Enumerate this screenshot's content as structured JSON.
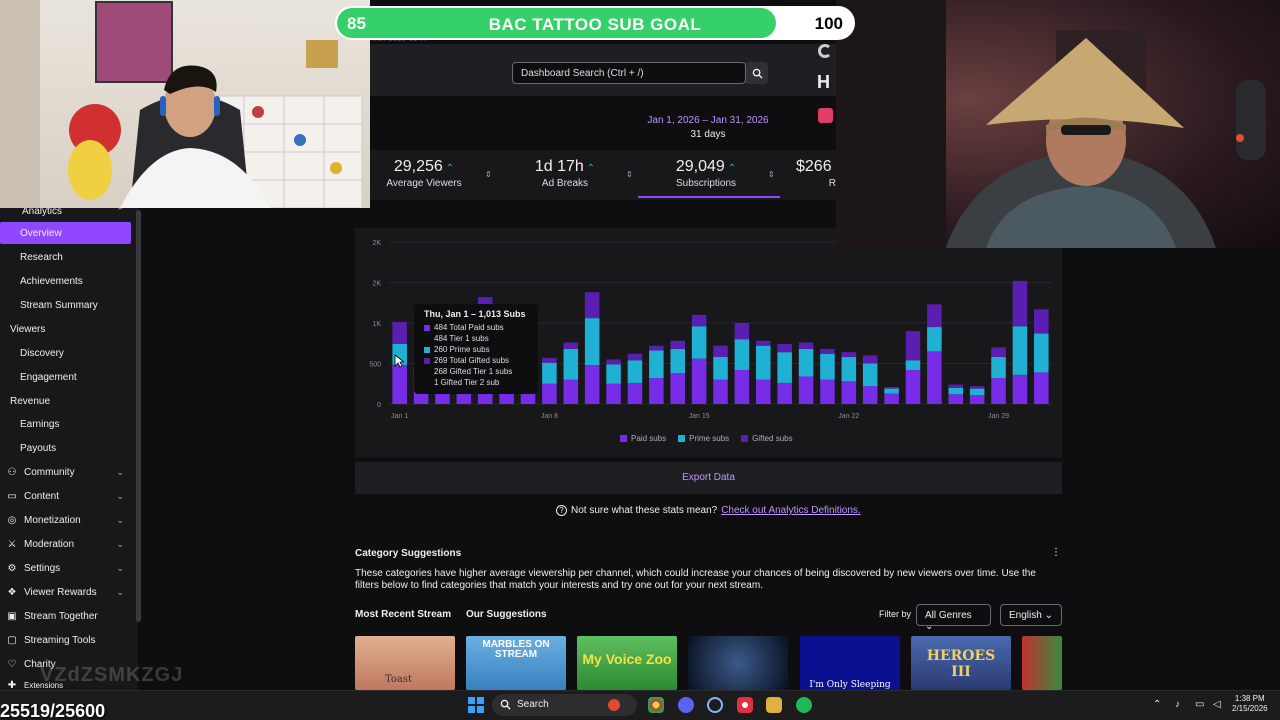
{
  "goal": {
    "current": "85",
    "title": "BAC TATTOO SUB GOAL",
    "target": "100",
    "progress": 0.85
  },
  "overlay": {
    "counter": "25519/25600",
    "watermark": "VZdZSMKZGJ"
  },
  "header": {
    "search_placeholder": "Dashboard Search (Ctrl + /)",
    "letter": "H",
    "breadcrumb": "...art 2026 01 ..."
  },
  "date": {
    "range": "Jan 1, 2026 – Jan 31, 2026",
    "days": "31 days"
  },
  "stats": [
    {
      "value": "29,256",
      "label": "Average Viewers"
    },
    {
      "value": "1d 17h",
      "label": "Ad Breaks"
    },
    {
      "value": "29,049",
      "label": "Subscriptions"
    },
    {
      "value": "$266",
      "label": "R"
    }
  ],
  "sidebar": {
    "analytics": "Analytics",
    "overview": "Overview",
    "research": "Research",
    "achievements": "Achievements",
    "stream_summary": "Stream Summary",
    "viewers": "Viewers",
    "discovery": "Discovery",
    "engagement": "Engagement",
    "revenue": "Revenue",
    "earnings": "Earnings",
    "payouts": "Payouts",
    "community": "Community",
    "content": "Content",
    "monetization": "Monetization",
    "moderation": "Moderation",
    "settings": "Settings",
    "viewer_rewards": "Viewer Rewards",
    "stream_together": "Stream Together",
    "streaming_tools": "Streaming Tools",
    "charity": "Charity",
    "extensions": "Extensions"
  },
  "chart_data": {
    "type": "bar",
    "stacked": true,
    "y_ticks": [
      "2K",
      "2K",
      "1K",
      "500",
      "0"
    ],
    "x_ticks": [
      "Jan 1",
      "Jan 8",
      "Jan 15",
      "Jan 22",
      "Jan 29"
    ],
    "categories": [
      "Jan 1",
      "Jan 2",
      "Jan 3",
      "Jan 4",
      "Jan 5",
      "Jan 6",
      "Jan 7",
      "Jan 8",
      "Jan 9",
      "Jan 10",
      "Jan 11",
      "Jan 12",
      "Jan 13",
      "Jan 14",
      "Jan 15",
      "Jan 16",
      "Jan 17",
      "Jan 18",
      "Jan 19",
      "Jan 20",
      "Jan 21",
      "Jan 22",
      "Jan 23",
      "Jan 24",
      "Jan 25",
      "Jan 26",
      "Jan 27",
      "Jan 28",
      "Jan 29",
      "Jan 30",
      "Jan 31"
    ],
    "series": [
      {
        "name": "Paid subs",
        "color": "#772ce8",
        "values": [
          484,
          350,
          300,
          280,
          900,
          420,
          300,
          250,
          300,
          480,
          250,
          260,
          320,
          380,
          560,
          300,
          420,
          300,
          260,
          340,
          300,
          280,
          220,
          130,
          420,
          650,
          120,
          110,
          320,
          360,
          390
        ]
      },
      {
        "name": "Prime subs",
        "color": "#1fb0d3",
        "values": [
          260,
          100,
          80,
          80,
          120,
          180,
          60,
          260,
          380,
          580,
          240,
          280,
          340,
          300,
          400,
          280,
          380,
          420,
          380,
          340,
          320,
          300,
          280,
          60,
          120,
          300,
          80,
          80,
          260,
          600,
          480
        ]
      },
      {
        "name": "Gifted subs",
        "color": "#5a1fb0",
        "values": [
          269,
          80,
          80,
          60,
          300,
          120,
          80,
          60,
          80,
          320,
          60,
          80,
          60,
          100,
          140,
          140,
          200,
          60,
          100,
          80,
          60,
          60,
          100,
          20,
          360,
          280,
          40,
          30,
          120,
          560,
          300
        ]
      }
    ],
    "legend": [
      "Paid subs",
      "Prime subs",
      "Gifted subs"
    ],
    "tooltip": {
      "title": "Thu, Jan 1 – 1,013 Subs",
      "rows": [
        "484 Total Paid subs",
        "484 Tier 1 subs",
        "260 Prime subs",
        "269 Total Gifted subs",
        "268 Gifted Tier 1 subs",
        "1 Gifted Tier 2 sub"
      ]
    },
    "export_label": "Export Data"
  },
  "definitions": {
    "text": "Not sure what these stats mean?",
    "link": "Check out Analytics Definitions."
  },
  "categories": {
    "title": "Category Suggestions",
    "description": "These categories have higher average viewership per channel, which could increase your chances of being discovered by new viewers over time. Use the filters below to find categories that match your interests and try one out for your next stream.",
    "tab_recent": "Most Recent Stream",
    "tab_suggestions": "Our Suggestions",
    "filter_label": "Filter by",
    "genre": "All Genres",
    "language": "English",
    "thumbs": [
      {
        "label": "Toast"
      },
      {
        "label": "MARBLES ON STREAM"
      },
      {
        "label": "My Voice Zoo"
      },
      {
        "label": ""
      },
      {
        "label": "I'm Only Sleeping"
      },
      {
        "label": "HEROES III"
      }
    ]
  },
  "taskbar": {
    "search": "Search",
    "time": "1:38 PM",
    "date": "2/15/2026"
  },
  "colors": {
    "accent": "#9147ff",
    "link": "#bf94ff",
    "up": "#00c8af",
    "goal": "#35d06a"
  }
}
